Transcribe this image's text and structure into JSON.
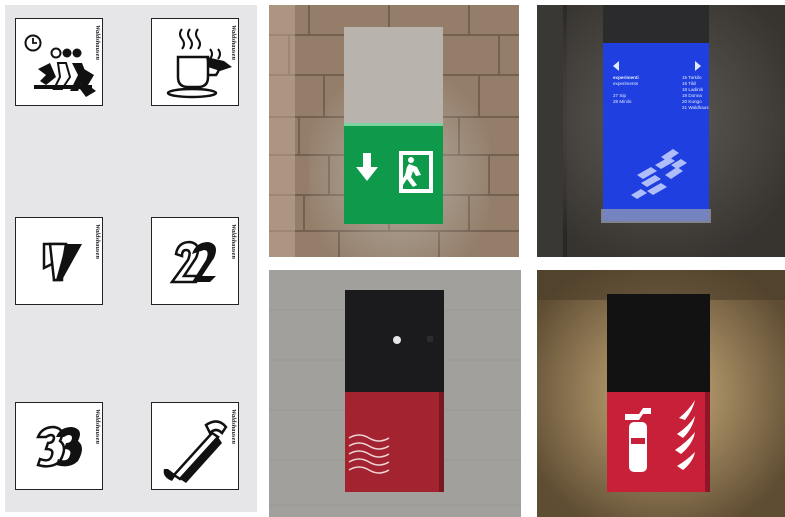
{
  "icon_panel": {
    "brand_mark": "Waldshausen",
    "icons": [
      {
        "name": "waiting-room-icon"
      },
      {
        "name": "coffee-cup-icon"
      },
      {
        "name": "floor-1-icon",
        "label": "1"
      },
      {
        "name": "floor-2-icon",
        "label": "2"
      },
      {
        "name": "floor-3-icon",
        "label": "3"
      },
      {
        "name": "telephone-icon"
      }
    ]
  },
  "photos": {
    "exit_sign": {
      "name": "emergency-exit-sign-photo",
      "panel_color": "#0f9a4b"
    },
    "directory_sign": {
      "name": "floor-directory-sign-photo",
      "panel_color": "#1f3fe0",
      "title": "experimenti",
      "subtitle": "experiments",
      "left_lines": [
        "27 Sip",
        "28 Minilo"
      ],
      "right_lines": [
        "15 Tarkilo",
        "16 Tikil",
        "18 Ladiniti",
        "19 Donna",
        "20 Kungo",
        "21 Waldhaus"
      ]
    },
    "red_fire_sign": {
      "name": "red-heating-panel-photo",
      "panel_color": "#a32430"
    },
    "fire_extinguisher_sign": {
      "name": "fire-extinguisher-sign-photo",
      "panel_color": "#c9203a"
    }
  }
}
